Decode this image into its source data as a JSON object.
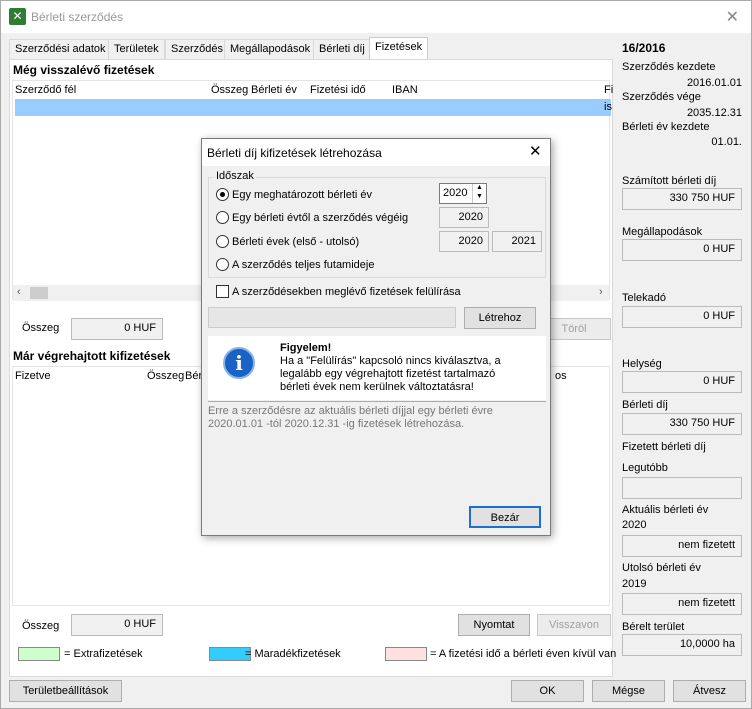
{
  "window": {
    "title": "Bérleti szerződés"
  },
  "tabs": [
    "Szerződési adatok",
    "Területek",
    "Szerződés",
    "Megállapodások",
    "Bérleti díj",
    "Fizetések"
  ],
  "upper": {
    "section_title": "Még visszalévő fizetések",
    "headers": [
      "Szerződő fél",
      "Összeg",
      "Bérleti év",
      "Fizetési idő",
      "IBAN",
      "Fi"
    ],
    "row_edge_text": "is",
    "total_label": "Összeg",
    "total_value": "0 HUF",
    "delete_button": "Töröl"
  },
  "lower": {
    "section_title": "Már végrehajtott kifizetések",
    "headers": [
      "Fizetve",
      "Összeg",
      "Bérl",
      "os"
    ],
    "total_label": "Összeg",
    "total_value": "0 HUF",
    "print_button": "Nyomtat",
    "revoke_button": "Visszavon"
  },
  "legend": [
    {
      "color": "#ccffcc",
      "label": "= Extrafizetések"
    },
    {
      "color": "#33ccff",
      "label": "= Maradékfizetések"
    },
    {
      "color": "#ffe0e0",
      "label": "= A fizetési idő a bérleti éven kívül van"
    }
  ],
  "footer": {
    "area_settings": "Területbeállítások",
    "ok": "OK",
    "cancel": "Mégse",
    "transfer": "Átvesz"
  },
  "side": {
    "contract_no": "16/2016",
    "start_label": "Szerződés kezdete",
    "start_value": "2016.01.01",
    "end_label": "Szerződés vége",
    "end_value": "2035.12.31",
    "year_start_label": "Bérleti év kezdete",
    "year_start_value": "01.01.",
    "calc_fee_label": "Számított bérleti díj",
    "calc_fee_value": "330 750 HUF",
    "agreements_label": "Megállapodások",
    "agreements_value": "0 HUF",
    "land_tax_label": "Telekadó",
    "land_tax_value": "0 HUF",
    "locality_label": "Helység",
    "locality_value": "0 HUF",
    "fee_label": "Bérleti díj",
    "fee_value": "330 750 HUF",
    "paid_fee_label": "Fizetett bérleti díj",
    "latest_label": "Legutóbb",
    "latest_value": "",
    "current_year_label": "Aktuális bérleti év",
    "current_year": "2020",
    "current_year_value": "nem fizetett",
    "last_year_label": "Utolsó bérleti év",
    "last_year": "2019",
    "last_year_value": "nem fizetett",
    "area_label": "Bérelt terület",
    "area_value": "10,0000 ha"
  },
  "dialog": {
    "title": "Bérleti díj kifizetések létrehozása",
    "group_label": "Időszak",
    "opt1": "Egy meghatározott bérleti év",
    "opt1_value": "2020",
    "opt2": "Egy bérleti évtől a szerződés végéig",
    "opt2_value": "2020",
    "opt3": "Bérleti évek (első - utolsó)",
    "opt3_from": "2020",
    "opt3_to": "2021",
    "opt4": "A szerződés teljes futamideje",
    "overwrite": "A szerződésekben meglévő fizetések felülírása",
    "create_button": "Létrehoz",
    "warn_title": "Figyelem!",
    "warn_text": "Ha a \"Felülírás\" kapcsoló nincs kiválasztva, a legalább egy végrehajtott fizetést tartalmazó bérleti évek nem kerülnek változtatásra!",
    "info_text": "Erre a szerződésre az aktuális bérleti díjjal egy bérleti évre 2020.01.01 -tól 2020.12.31 -ig fizetések létrehozása.",
    "close_button": "Bezár"
  }
}
